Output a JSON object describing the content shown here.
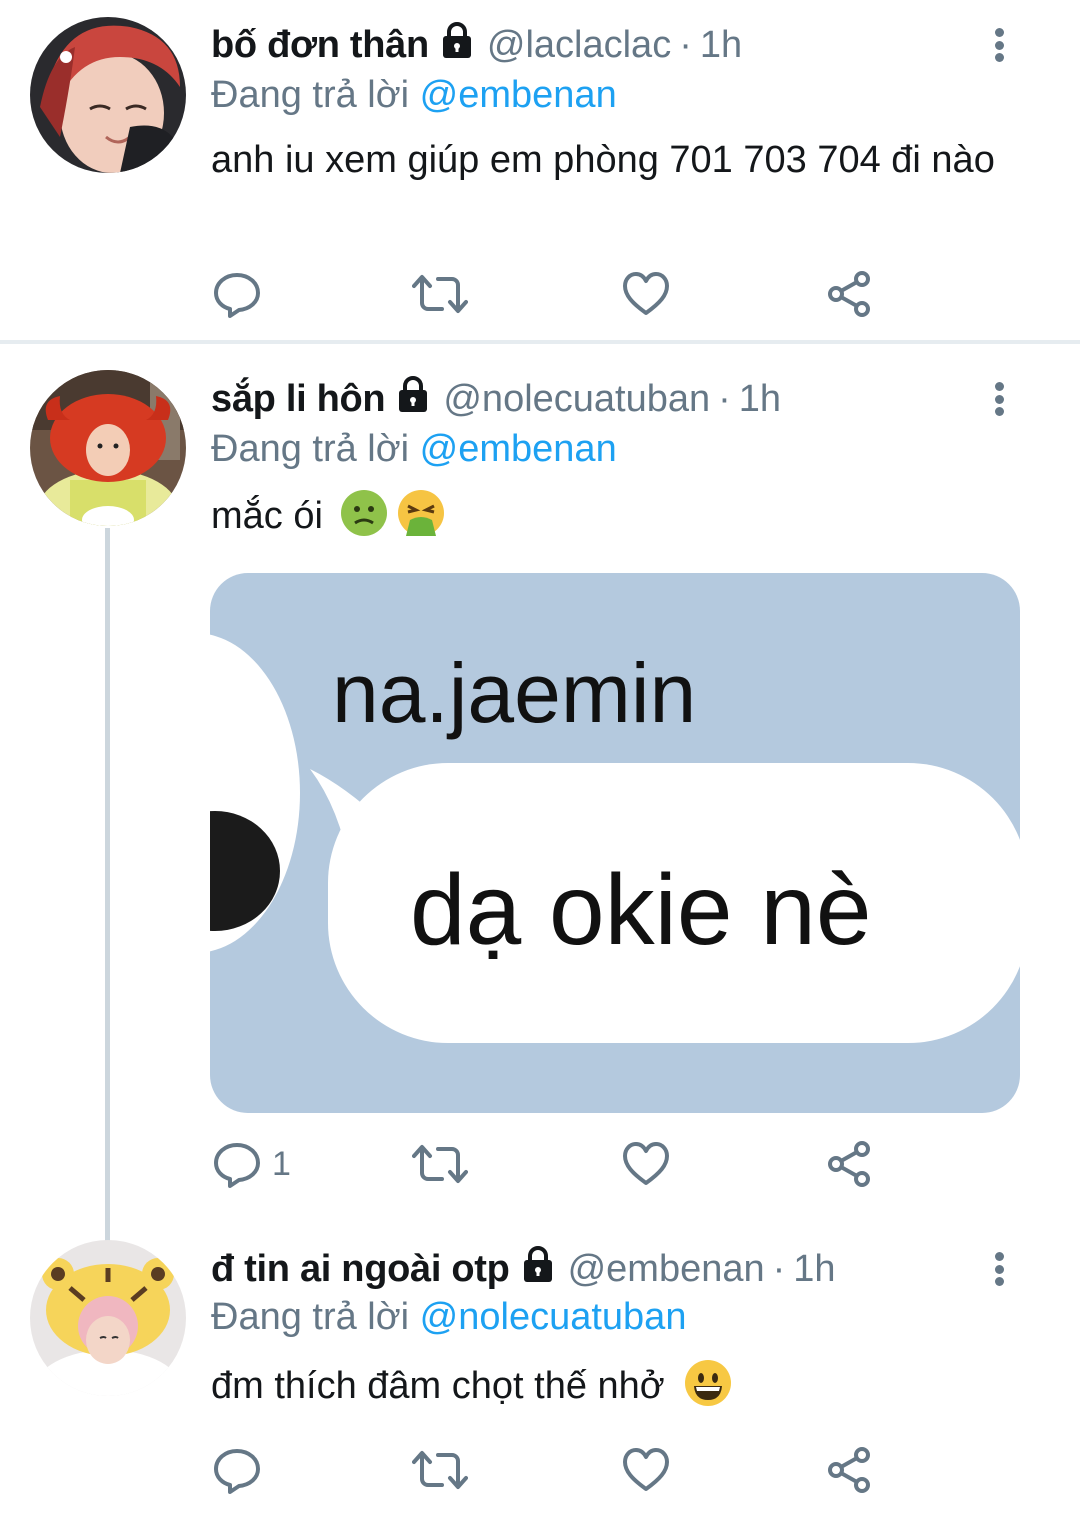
{
  "tweets": [
    {
      "display_name": "bố đơn thân",
      "handle": "@laclaclac",
      "time": "1h",
      "reply_prefix": "Đang trả lời",
      "reply_to": "@embenan",
      "text": "anh iu xem giúp em phòng 701 703 704 đi nào",
      "reply_count": ""
    },
    {
      "display_name": "sắp li hôn",
      "handle": "@nolecuatuban",
      "time": "1h",
      "reply_prefix": "Đang trả lời",
      "reply_to": "@embenan",
      "text": "mắc ói",
      "emojis": [
        "nauseated-face",
        "vomiting-face"
      ],
      "media": {
        "sender": "na.jaemin",
        "message": "dạ okie nè"
      },
      "reply_count": "1"
    },
    {
      "display_name": "đ tin ai ngoài otp",
      "handle": "@embenan",
      "time": "1h",
      "reply_prefix": "Đang trả lời",
      "reply_to": "@nolecuatuban",
      "text": "đm thích đâm chọt thế nhở",
      "emojis": [
        "grinning-face"
      ],
      "reply_count": ""
    }
  ],
  "separator": "·",
  "colors": {
    "accent": "#1da1f2",
    "muted": "#657786",
    "text": "#14171a",
    "divider": "#e6ecf0",
    "thread_line": "#ccd6dd"
  },
  "icons": [
    "reply-icon",
    "retweet-icon",
    "like-icon",
    "share-icon",
    "lock-icon",
    "more-icon"
  ]
}
